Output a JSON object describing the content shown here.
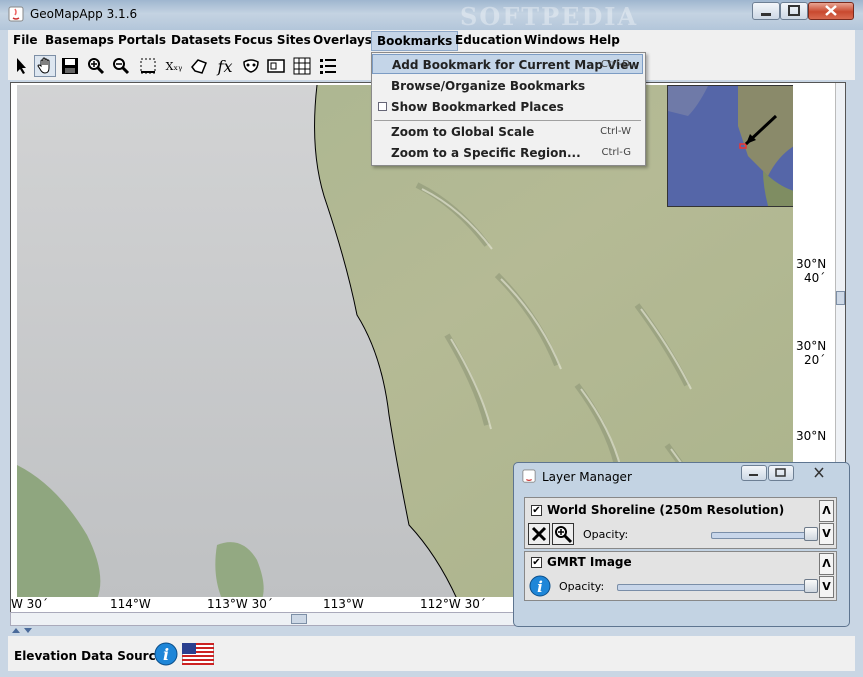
{
  "window": {
    "title": "GeoMapApp 3.1.6",
    "watermark": "SOFTPEDIA"
  },
  "menubar": {
    "items": [
      "File",
      "Basemaps",
      "Portals",
      "Datasets",
      "Focus Sites",
      "Overlays",
      "Bookmarks",
      "Education",
      "Windows",
      "Help"
    ],
    "active": "Bookmarks"
  },
  "toolbar": {
    "tools": [
      "pointer-icon",
      "hand-pan-icon",
      "save-icon",
      "zoom-in-icon",
      "zoom-out-icon",
      "select-region-icon",
      "xyz-icon",
      "polygon-icon",
      "fx-icon",
      "mask-icon",
      "frame-icon",
      "grid-icon",
      "list-icon"
    ],
    "selected": "hand-pan-icon",
    "xyz_label": "Xₓᵧ",
    "fx_label": "fx"
  },
  "bookmarks_menu": {
    "items": [
      {
        "label": "Add Bookmark for Current Map View",
        "accelerator": "Ctrl-D",
        "highlighted": true
      },
      {
        "label": "Browse/Organize Bookmarks",
        "accelerator": ""
      },
      {
        "label": "Show Bookmarked Places",
        "accelerator": "",
        "checkbox": true,
        "checked": false
      },
      {
        "label": "Zoom to Global Scale",
        "accelerator": "Ctrl-W"
      },
      {
        "label": "Zoom to a Specific Region...",
        "accelerator": "Ctrl-G"
      }
    ]
  },
  "map": {
    "longitude_labels": [
      "W 30´",
      "114°W",
      "113°W 30´",
      "113°W",
      "112°W 30´"
    ],
    "latitude_labels": [
      {
        "deg": "30°N",
        "min": "40´"
      },
      {
        "deg": "30°N",
        "min": "20´"
      },
      {
        "deg": "30°N",
        "min": ""
      }
    ]
  },
  "layer_manager": {
    "title": "Layer Manager",
    "layers": [
      {
        "name": "World Shoreline (250m Resolution)",
        "checked": true,
        "opacity_label": "Opacity:",
        "opacity": 1.0
      },
      {
        "name": "GMRT Image",
        "checked": true,
        "opacity_label": "Opacity:",
        "opacity": 1.0
      }
    ]
  },
  "statusbar": {
    "label": "Elevation Data Sources"
  },
  "colors": {
    "menu_highlight": "#c4d5e8",
    "window_frame": "#c9d6e4",
    "ocean": "#c8cacd",
    "land": "#9aab86"
  }
}
